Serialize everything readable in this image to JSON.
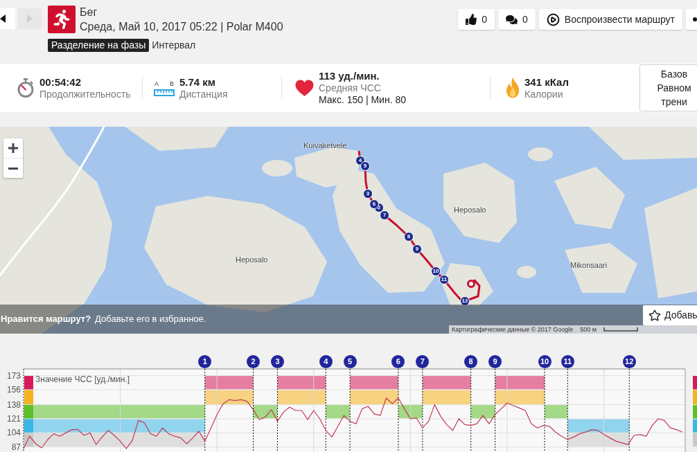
{
  "nav": {
    "back": {
      "disabled": false
    },
    "forward": {
      "disabled": true
    }
  },
  "activity": {
    "title": "Бег",
    "subtitle": "Среда, Май 10, 2017 05:22 | Polar M400",
    "tags": [
      {
        "label": "Разделение на фазы",
        "kind": "badge"
      },
      {
        "label": "Интервал",
        "kind": "plain"
      }
    ]
  },
  "actions": [
    {
      "kind": "like",
      "label": "0"
    },
    {
      "kind": "comments",
      "label": "0"
    },
    {
      "kind": "replay",
      "label": "Воспроизвести маршрут"
    },
    {
      "kind": "more"
    }
  ],
  "stats": [
    {
      "kind": "duration",
      "value": "00:54:42",
      "label": "Продолжительность"
    },
    {
      "kind": "distance",
      "icon_marks": [
        "A",
        "B"
      ],
      "value": "5.74 км",
      "label": "Дистанция"
    },
    {
      "kind": "heart_rate",
      "value": "113 уд./мин.",
      "label": "Средняя ЧСС",
      "detail": "Макс. 150 | Мин. 80"
    },
    {
      "kind": "calories",
      "value": "341 кКал",
      "label": "Калории"
    }
  ],
  "training_benefit": {
    "lines": [
      "Базов",
      "Равном",
      "трени"
    ]
  },
  "map": {
    "places": [
      "Kuivaketvele",
      "Heposalo",
      "Heposalo",
      "Mikonsaari"
    ],
    "markers": [
      "2",
      "3",
      "4",
      "5",
      "6",
      "7",
      "8",
      "9",
      "10",
      "11",
      "12"
    ],
    "banner": {
      "question": "Нравится маршрут?",
      "text": "Добавьте его в избранное.",
      "button": "Добавь"
    },
    "attribution": "Картографические данные © 2017 Google",
    "scale": "500 м"
  },
  "hr_chart": {
    "laps": [
      "1",
      "2",
      "3",
      "4",
      "5",
      "6",
      "7",
      "8",
      "9",
      "10",
      "11",
      "12"
    ],
    "zones": [
      {
        "color": "#d6195a"
      },
      {
        "color": "#f5b21f"
      },
      {
        "color": "#5cbf2a"
      },
      {
        "color": "#3ab7e6"
      },
      {
        "color": "#c9c9c9"
      }
    ],
    "segments": [
      {
        "kind": "warmup"
      },
      {
        "kind": "interval"
      },
      {
        "kind": "recovery"
      },
      {
        "kind": "interval"
      },
      {
        "kind": "recovery"
      },
      {
        "kind": "interval"
      },
      {
        "kind": "recovery"
      },
      {
        "kind": "interval"
      },
      {
        "kind": "recovery"
      },
      {
        "kind": "interval"
      },
      {
        "kind": "recovery"
      },
      {
        "kind": "cooldown"
      },
      {
        "kind": "free"
      }
    ],
    "chart_data": {
      "type": "line",
      "grid": true,
      "ylabel": "Значение ЧСС [уд./мин.]",
      "ylim": [
        81,
        181
      ],
      "yticks": [
        87,
        104,
        121,
        138,
        156,
        173
      ],
      "categories": [
        null,
        null,
        null,
        null,
        null,
        null,
        null,
        null,
        null,
        null,
        null,
        null,
        null,
        null,
        null,
        null,
        null,
        null,
        null,
        null,
        null,
        null,
        null,
        null,
        null,
        null,
        null,
        null,
        null,
        null,
        null,
        null,
        null,
        null,
        null,
        null,
        null,
        null,
        null,
        null,
        null,
        null,
        null,
        null,
        null,
        null,
        null,
        null,
        null,
        null,
        null,
        null,
        null,
        null,
        null,
        null,
        null,
        null,
        null,
        null,
        null,
        null,
        null,
        null,
        null,
        null,
        null,
        null,
        null,
        null,
        null,
        null,
        null,
        null,
        null,
        null,
        null,
        null,
        null,
        null,
        null,
        null,
        null,
        null,
        null,
        null,
        null,
        null,
        null,
        null,
        null,
        null,
        null,
        null,
        null,
        null,
        null,
        null,
        null,
        null,
        null,
        null,
        null,
        null,
        null,
        null,
        null,
        null,
        null,
        null
      ],
      "series": [
        {
          "color": "#c23b55",
          "values": [
            85,
            100,
            91,
            86,
            96,
            103,
            100,
            104,
            108,
            108,
            101,
            104,
            90,
            99,
            107,
            101,
            94,
            85,
            95,
            119,
            116,
            103,
            100,
            110,
            103,
            100,
            98,
            91,
            98,
            106,
            94,
            110,
            126,
            139,
            144,
            143,
            144,
            142,
            132,
            120,
            123,
            132,
            118,
            129,
            135,
            131,
            131,
            120,
            131,
            121,
            107,
            99,
            112,
            125,
            118,
            115,
            133,
            136,
            127,
            125,
            146,
            139,
            146,
            133,
            121,
            122,
            110,
            118,
            138,
            124,
            114,
            107,
            121,
            114,
            113,
            115,
            125,
            115,
            126,
            133,
            140,
            137,
            134,
            131,
            115,
            110,
            113,
            112,
            105,
            100,
            96,
            99,
            103,
            105,
            108,
            107,
            102,
            98,
            94,
            92,
            90,
            101,
            102,
            100,
            113,
            121,
            119,
            110,
            108,
            105
          ]
        }
      ]
    }
  }
}
